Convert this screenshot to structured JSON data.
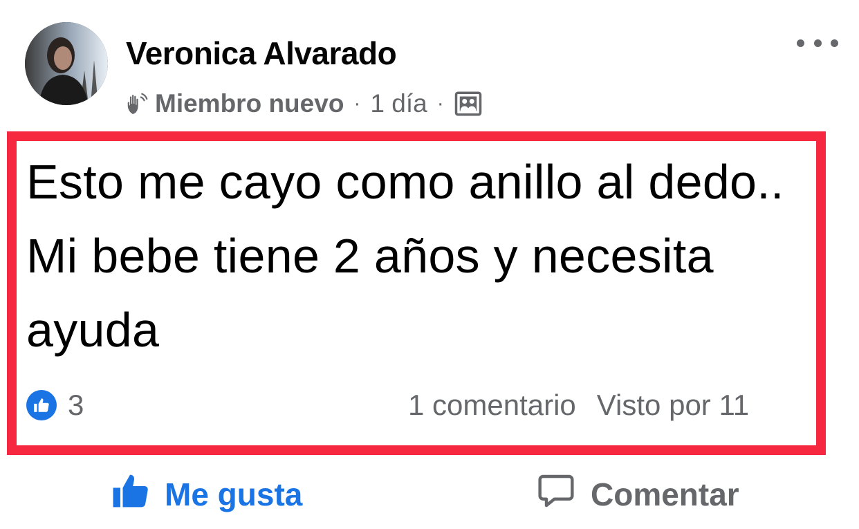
{
  "post": {
    "author": "Veronica Alvarado",
    "member_badge": "Miembro nuevo",
    "separator": "·",
    "time": "1 día",
    "text": "Esto me cayo como anillo al dedo.. Mi bebe tiene 2 años y necesita ayuda",
    "reaction_count": "3",
    "comment_count": "1 comentario",
    "views": "Visto por 11"
  },
  "actions": {
    "like_label": "Me gusta",
    "comment_label": "Comentar"
  },
  "icons": {
    "badge": "waving-hand-icon",
    "audience": "group-audience-icon",
    "more": "more-dots-icon",
    "reaction": "like-reaction-icon",
    "like": "thumbs-up-icon",
    "comment": "comment-bubble-icon"
  },
  "colors": {
    "highlight_border": "#f5283f",
    "facebook_blue": "#1b74e4",
    "secondary_text": "#65676b"
  }
}
